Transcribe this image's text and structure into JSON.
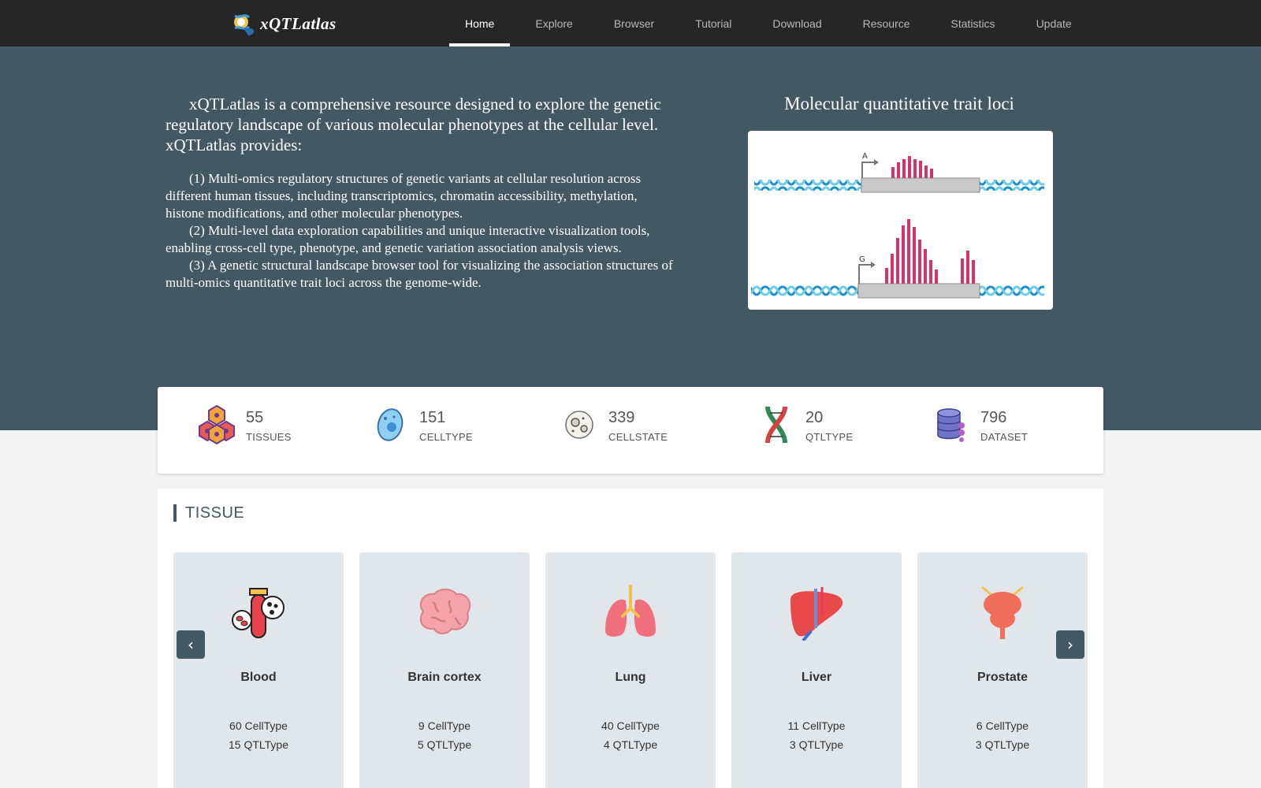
{
  "header": {
    "logo_text": "xQTLatlas",
    "nav": [
      {
        "label": "Home",
        "active": true
      },
      {
        "label": "Explore"
      },
      {
        "label": "Browser"
      },
      {
        "label": "Tutorial"
      },
      {
        "label": "Download"
      },
      {
        "label": "Resource"
      },
      {
        "label": "Statistics"
      },
      {
        "label": "Update"
      }
    ]
  },
  "hero": {
    "intro": "xQTLatlas is a comprehensive resource designed to explore the genetic regulatory landscape of various molecular phenotypes at the cellular level. xQTLatlas provides:",
    "points": [
      "(1) Multi-omics regulatory structures of genetic variants at cellular resolution across different human tissues, including transcriptomics, chromatin accessibility, methylation, histone modifications, and other molecular phenotypes.",
      "(2) Multi-level data exploration capabilities and unique interactive visualization tools, enabling cross-cell type, phenotype, and genetic variation association analysis views.",
      "(3) A genetic structural landscape browser tool for visualizing the association structures of multi-omics quantitative trait loci across the genome-wide."
    ],
    "right_title": "Molecular quantitative trait loci",
    "diagram": {
      "label_top": "A",
      "label_bottom": "G"
    }
  },
  "stats": [
    {
      "value": "55",
      "label": "TISSUES",
      "icon": "tissues-icon"
    },
    {
      "value": "151",
      "label": "CELLTYPE",
      "icon": "celltype-icon"
    },
    {
      "value": "339",
      "label": "CELLSTATE",
      "icon": "cellstate-icon"
    },
    {
      "value": "20",
      "label": "QTLTYPE",
      "icon": "dna-icon"
    },
    {
      "value": "796",
      "label": "DATASET",
      "icon": "database-icon"
    }
  ],
  "tissue": {
    "title": "TISSUE",
    "cards": [
      {
        "name": "Blood",
        "celltype": "60 CellType",
        "qtltype": "15 QTLType",
        "icon": "blood-icon"
      },
      {
        "name": "Brain cortex",
        "celltype": "9 CellType",
        "qtltype": "5 QTLType",
        "icon": "brain-icon"
      },
      {
        "name": "Lung",
        "celltype": "40 CellType",
        "qtltype": "4 QTLType",
        "icon": "lung-icon"
      },
      {
        "name": "Liver",
        "celltype": "11 CellType",
        "qtltype": "3 QTLType",
        "icon": "liver-icon"
      },
      {
        "name": "Prostate",
        "celltype": "6 CellType",
        "qtltype": "3 QTLType",
        "icon": "prostate-icon"
      }
    ],
    "prev_glyph": "‹",
    "next_glyph": "›"
  },
  "colors": {
    "navbar": "#262626",
    "hero": "#435865",
    "card": "#e1e6ea",
    "accent": "#d6336c"
  }
}
